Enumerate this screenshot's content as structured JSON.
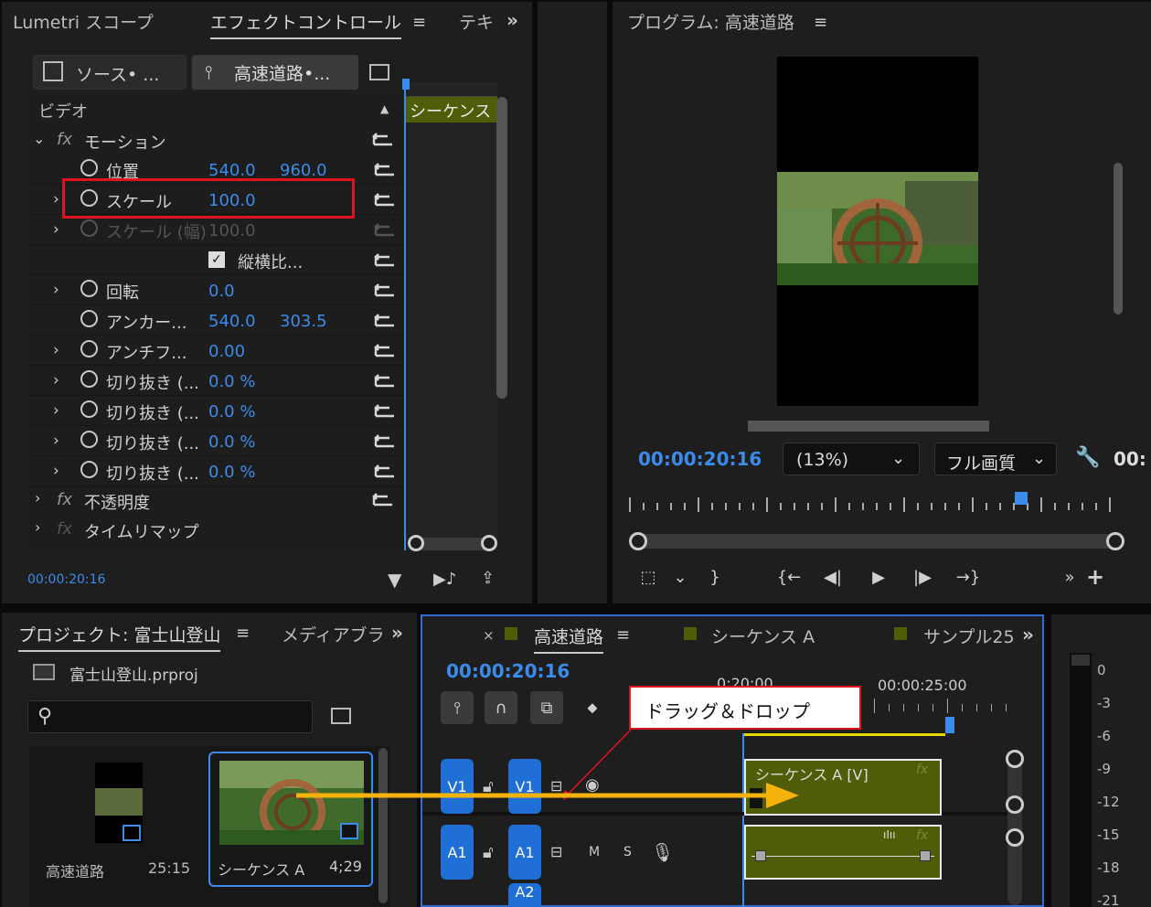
{
  "effect_panel": {
    "tabs": [
      "Lumetri スコープ",
      "エフェクトコントロール",
      "テキ"
    ],
    "source_tab": "ソース• ...",
    "sequence_tab": "高速道路•...",
    "section": "ビデオ",
    "timeline_label": "シーケンス",
    "motion_label": "モーション",
    "rows": [
      {
        "label": "位置",
        "v1": "540.0",
        "v2": "960.0"
      },
      {
        "label": "スケール",
        "v1": "100.0",
        "v2": ""
      },
      {
        "label": "スケール (幅)",
        "v1": "100.0",
        "v2": ""
      },
      {
        "label": "縦横比...",
        "v1": "",
        "v2": ""
      },
      {
        "label": "回転",
        "v1": "0.0",
        "v2": ""
      },
      {
        "label": "アンカー...",
        "v1": "540.0",
        "v2": "303.5"
      },
      {
        "label": "アンチフ...",
        "v1": "0.00",
        "v2": ""
      },
      {
        "label": "切り抜き (...",
        "v1": "0.0 %",
        "v2": ""
      },
      {
        "label": "切り抜き (...",
        "v1": "0.0 %",
        "v2": ""
      },
      {
        "label": "切り抜き (...",
        "v1": "0.0 %",
        "v2": ""
      },
      {
        "label": "切り抜き (...",
        "v1": "0.0 %",
        "v2": ""
      }
    ],
    "opacity_label": "不透明度",
    "timeremap_label": "タイムリマップ",
    "timecode": "00:00:20:16"
  },
  "program": {
    "title": "プログラム: 高速道路",
    "timecode": "00:00:20:16",
    "zoom": "(13%)",
    "quality": "フル画質",
    "extra_timecode": "00:"
  },
  "project": {
    "title": "プロジェクト: 富士山登山",
    "media_tab": "メディアブラ",
    "file": "富士山登山.prproj",
    "search_placeholder": "",
    "items": [
      {
        "name": "高速道路",
        "duration": "25:15"
      },
      {
        "name": "シーケンス A",
        "duration": "4;29"
      }
    ]
  },
  "timeline": {
    "tabs": [
      "高速道路",
      "シーケンス A",
      "サンプル25"
    ],
    "timecode": "00:00:20:16",
    "ruler_left": "0:20:00",
    "ruler_right": "00:00:25:00",
    "v1": "V1",
    "a1": "A1",
    "a2": "A2",
    "m": "M",
    "s": "S",
    "clip_label": "シーケンス A [V]"
  },
  "annotation": {
    "text": "ドラッグ＆ドロップ"
  },
  "meter": {
    "labels": [
      "0",
      "-3",
      "-6",
      "-9",
      "-12",
      "-15",
      "-18",
      "-21"
    ]
  },
  "colors": {
    "accent": "#3b8bea",
    "highlight": "#e0141e",
    "arrow": "#f5b20a",
    "clip": "#4f5d08"
  }
}
